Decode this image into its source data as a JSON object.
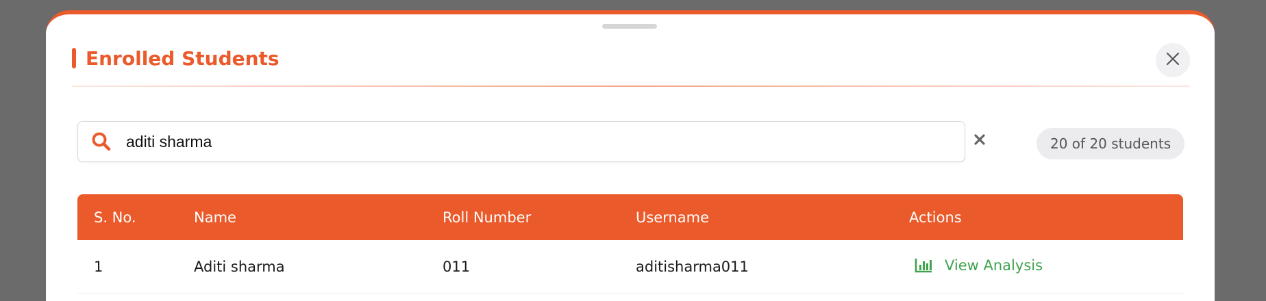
{
  "modal": {
    "title": "Enrolled Students",
    "accent_color": "#eb5a2a"
  },
  "search": {
    "value": "aditi sharma",
    "placeholder": ""
  },
  "count_badge": "20 of 20 students",
  "table": {
    "headers": [
      "S. No.",
      "Name",
      "Roll Number",
      "Username",
      "Actions"
    ],
    "rows": [
      {
        "sno": "1",
        "name": "Aditi sharma",
        "roll": "011",
        "username": "aditisharma011",
        "action_label": "View Analysis",
        "action_icon": "bar-chart-icon"
      }
    ]
  },
  "icons": {
    "search": "search-icon",
    "clear": "clear-icon",
    "close": "close-icon"
  },
  "colors": {
    "header_bg": "#eb5a2a",
    "action_green": "#3fa34d"
  }
}
